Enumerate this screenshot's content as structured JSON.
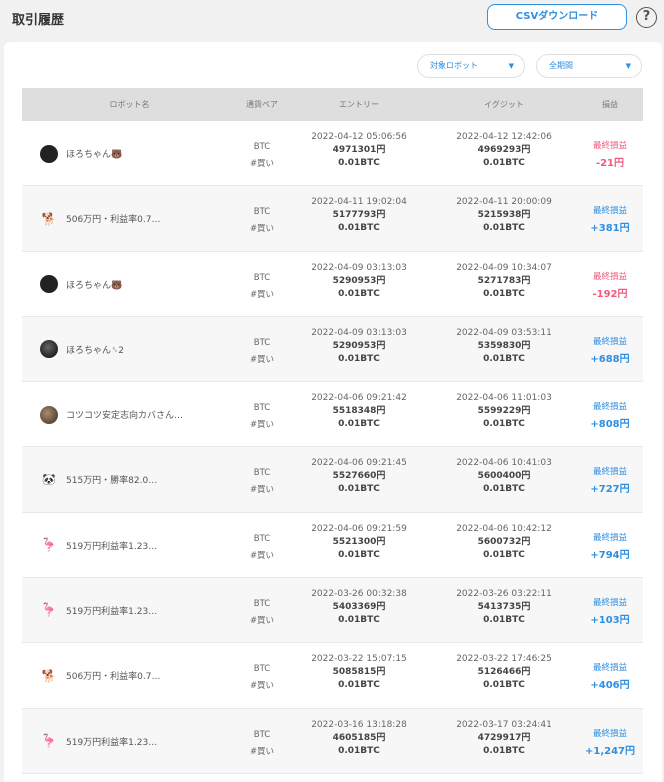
{
  "header": {
    "title": "取引履歴",
    "csv_button": "CSVダウンロード",
    "help": "?"
  },
  "filters": {
    "robot": "対象ロボット",
    "period": "全期間"
  },
  "table": {
    "columns": [
      "ロボット名",
      "通貨ペア",
      "エントリー",
      "イグジット",
      "損益"
    ],
    "rows": [
      {
        "robot": "ほろちゃん🐻",
        "avatar": "dark-round",
        "pair": "BTC",
        "side": "#買い",
        "entry_time": "2022-04-12 05:06:56",
        "entry_price": "4971301円",
        "entry_qty": "0.01BTC",
        "exit_time": "2022-04-12 12:42:06",
        "exit_price": "4969293円",
        "exit_qty": "0.01BTC",
        "pl_label": "最終損益",
        "pl_value": "-21円",
        "pl_sign": "neg"
      },
      {
        "robot": "506万円・利益率0.7…",
        "avatar": "dog",
        "pair": "BTC",
        "side": "#買い",
        "entry_time": "2022-04-11 19:02:04",
        "entry_price": "5177793円",
        "entry_qty": "0.01BTC",
        "exit_time": "2022-04-11 20:00:09",
        "exit_price": "5215938円",
        "exit_qty": "0.01BTC",
        "pl_label": "最終損益",
        "pl_value": "+381円",
        "pl_sign": "pos"
      },
      {
        "robot": "ほろちゃん🐻",
        "avatar": "dark-round",
        "pair": "BTC",
        "side": "#買い",
        "entry_time": "2022-04-09 03:13:03",
        "entry_price": "5290953円",
        "entry_qty": "0.01BTC",
        "exit_time": "2022-04-09 10:34:07",
        "exit_price": "5271783円",
        "exit_qty": "0.01BTC",
        "pl_label": "最終損益",
        "pl_value": "-192円",
        "pl_sign": "neg"
      },
      {
        "robot": "ほろちゃん␈2",
        "avatar": "grey-round",
        "pair": "BTC",
        "side": "#買い",
        "entry_time": "2022-04-09 03:13:03",
        "entry_price": "5290953円",
        "entry_qty": "0.01BTC",
        "exit_time": "2022-04-09 03:53:11",
        "exit_price": "5359830円",
        "exit_qty": "0.01BTC",
        "pl_label": "最終損益",
        "pl_value": "+688円",
        "pl_sign": "pos"
      },
      {
        "robot": "コツコツ安定志向カバさん…",
        "avatar": "cow",
        "pair": "BTC",
        "side": "#買い",
        "entry_time": "2022-04-06 09:21:42",
        "entry_price": "5518348円",
        "entry_qty": "0.01BTC",
        "exit_time": "2022-04-06 11:01:03",
        "exit_price": "5599229円",
        "exit_qty": "0.01BTC",
        "pl_label": "最終損益",
        "pl_value": "+808円",
        "pl_sign": "pos"
      },
      {
        "robot": "515万円・勝率82.0…",
        "avatar": "panda",
        "pair": "BTC",
        "side": "#買い",
        "entry_time": "2022-04-06 09:21:45",
        "entry_price": "5527660円",
        "entry_qty": "0.01BTC",
        "exit_time": "2022-04-06 10:41:03",
        "exit_price": "5600400円",
        "exit_qty": "0.01BTC",
        "pl_label": "最終損益",
        "pl_value": "+727円",
        "pl_sign": "pos"
      },
      {
        "robot": "519万円利益率1.23…",
        "avatar": "flamingo",
        "pair": "BTC",
        "side": "#買い",
        "entry_time": "2022-04-06 09:21:59",
        "entry_price": "5521300円",
        "entry_qty": "0.01BTC",
        "exit_time": "2022-04-06 10:42:12",
        "exit_price": "5600732円",
        "exit_qty": "0.01BTC",
        "pl_label": "最終損益",
        "pl_value": "+794円",
        "pl_sign": "pos"
      },
      {
        "robot": "519万円利益率1.23…",
        "avatar": "flamingo",
        "pair": "BTC",
        "side": "#買い",
        "entry_time": "2022-03-26 00:32:38",
        "entry_price": "5403369円",
        "entry_qty": "0.01BTC",
        "exit_time": "2022-03-26 03:22:11",
        "exit_price": "5413735円",
        "exit_qty": "0.01BTC",
        "pl_label": "最終損益",
        "pl_value": "+103円",
        "pl_sign": "pos"
      },
      {
        "robot": "506万円・利益率0.7…",
        "avatar": "dog",
        "pair": "BTC",
        "side": "#買い",
        "entry_time": "2022-03-22 15:07:15",
        "entry_price": "5085815円",
        "entry_qty": "0.01BTC",
        "exit_time": "2022-03-22 17:46:25",
        "exit_price": "5126466円",
        "exit_qty": "0.01BTC",
        "pl_label": "最終損益",
        "pl_value": "+406円",
        "pl_sign": "pos"
      },
      {
        "robot": "519万円利益率1.23…",
        "avatar": "flamingo",
        "pair": "BTC",
        "side": "#買い",
        "entry_time": "2022-03-16 13:18:28",
        "entry_price": "4605185円",
        "entry_qty": "0.01BTC",
        "exit_time": "2022-03-17 03:24:41",
        "exit_price": "4729917円",
        "exit_qty": "0.01BTC",
        "pl_label": "最終損益",
        "pl_value": "+1,247円",
        "pl_sign": "pos"
      }
    ]
  },
  "colors": {
    "accent": "#2f8fe0",
    "loss": "#f05b7d",
    "profit": "#2f8fe0"
  }
}
